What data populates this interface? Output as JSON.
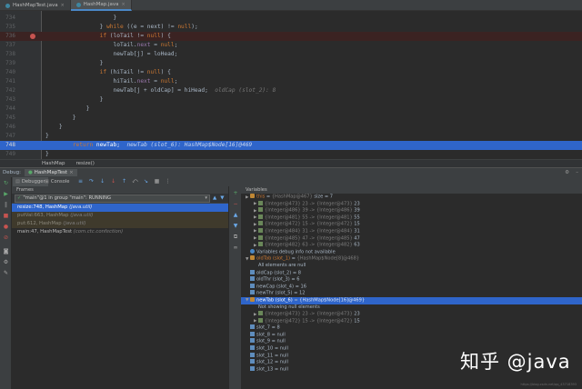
{
  "tabs": [
    {
      "label": "HashMapTest.java",
      "active": false
    },
    {
      "label": "HashMap.java",
      "active": true
    }
  ],
  "editor": {
    "lines": [
      {
        "no": "734",
        "parts": [
          {
            "t": "                    }",
            "c": ""
          }
        ]
      },
      {
        "no": "735",
        "parts": [
          {
            "t": "                } ",
            "c": ""
          },
          {
            "t": "while",
            "c": "kw"
          },
          {
            "t": " ((e = next) != ",
            "c": ""
          },
          {
            "t": "null",
            "c": "kw"
          },
          {
            "t": ");",
            "c": ""
          }
        ]
      },
      {
        "no": "736",
        "bp": true,
        "parts": [
          {
            "t": "                ",
            "c": ""
          },
          {
            "t": "if",
            "c": "kw"
          },
          {
            "t": " (loTail != ",
            "c": ""
          },
          {
            "t": "null",
            "c": "kw"
          },
          {
            "t": ") {",
            "c": ""
          }
        ]
      },
      {
        "no": "737",
        "parts": [
          {
            "t": "                    loTail.",
            "c": ""
          },
          {
            "t": "next",
            "c": "fld"
          },
          {
            "t": " = ",
            "c": ""
          },
          {
            "t": "null",
            "c": "kw"
          },
          {
            "t": ";",
            "c": ""
          }
        ]
      },
      {
        "no": "738",
        "parts": [
          {
            "t": "                    newTab[j] = loHead;",
            "c": ""
          }
        ]
      },
      {
        "no": "739",
        "parts": [
          {
            "t": "                }",
            "c": ""
          }
        ]
      },
      {
        "no": "740",
        "parts": [
          {
            "t": "                ",
            "c": ""
          },
          {
            "t": "if",
            "c": "kw"
          },
          {
            "t": " (hiTail != ",
            "c": ""
          },
          {
            "t": "null",
            "c": "kw"
          },
          {
            "t": ") {",
            "c": ""
          }
        ]
      },
      {
        "no": "741",
        "parts": [
          {
            "t": "                    hiTail.",
            "c": ""
          },
          {
            "t": "next",
            "c": "fld"
          },
          {
            "t": " = ",
            "c": ""
          },
          {
            "t": "null",
            "c": "kw"
          },
          {
            "t": ";",
            "c": ""
          }
        ]
      },
      {
        "no": "742",
        "parts": [
          {
            "t": "                    newTab[j + oldCap] = hiHead;  ",
            "c": ""
          },
          {
            "t": "oldCap (slot_2): 8",
            "c": "hint"
          }
        ]
      },
      {
        "no": "743",
        "parts": [
          {
            "t": "                }",
            "c": ""
          }
        ]
      },
      {
        "no": "744",
        "parts": [
          {
            "t": "            }",
            "c": ""
          }
        ]
      },
      {
        "no": "745",
        "parts": [
          {
            "t": "        }",
            "c": ""
          }
        ]
      },
      {
        "no": "746",
        "parts": [
          {
            "t": "    }",
            "c": ""
          }
        ]
      },
      {
        "no": "747",
        "parts": [
          {
            "t": "}",
            "c": ""
          }
        ]
      },
      {
        "no": "748",
        "cur": true,
        "parts": [
          {
            "t": "        ",
            "c": ""
          },
          {
            "t": "return",
            "c": "kw"
          },
          {
            "t": " newTab;  ",
            "c": ""
          },
          {
            "t": "newTab (slot_6): HashMap$Node[16]@469",
            "c": "hint"
          }
        ]
      },
      {
        "no": "749",
        "parts": [
          {
            "t": "}",
            "c": ""
          }
        ]
      }
    ]
  },
  "breadcrumb": [
    "HashMap",
    "resize()"
  ],
  "debug": {
    "title": "Debug:",
    "config": "HashMapTest",
    "subtabs": [
      "Debugger",
      "Console"
    ],
    "frames_title": "Frames",
    "variables_title": "Variables",
    "thread": "\"main\"@1 in group \"main\": RUNNING",
    "frames": [
      {
        "label": "resize:748, HashMap ",
        "src": "(java.util)",
        "kind": "active"
      },
      {
        "label": "putVal:663, HashMap ",
        "src": "(java.util)",
        "kind": "lib"
      },
      {
        "label": "put:612, HashMap ",
        "src": "(java.util)",
        "kind": "lib"
      },
      {
        "label": "main:47, HashMapTest ",
        "src": "(com.ctc.confection)",
        "kind": "normal"
      }
    ]
  },
  "variables": [
    {
      "indent": 0,
      "arrow": "▶",
      "icon": "obj",
      "name": "this",
      "val": " = ",
      "dim": "{HashMap@467}",
      "rest": "  size = 7"
    },
    {
      "indent": 1,
      "arrow": "▶",
      "icon": "arr",
      "name": "",
      "val": "",
      "dim": "{Integer@473} 23 -> {Integer@473}",
      "rest": " 23"
    },
    {
      "indent": 1,
      "arrow": "▶",
      "icon": "arr",
      "name": "",
      "val": "",
      "dim": "{Integer@486} 39 -> {Integer@486}",
      "rest": " 39"
    },
    {
      "indent": 1,
      "arrow": "▶",
      "icon": "arr",
      "name": "",
      "val": "",
      "dim": "{Integer@481} 55 -> {Integer@481}",
      "rest": " 55"
    },
    {
      "indent": 1,
      "arrow": "▶",
      "icon": "arr",
      "name": "",
      "val": "",
      "dim": "{Integer@472} 15 -> {Integer@472}",
      "rest": " 15"
    },
    {
      "indent": 1,
      "arrow": "▶",
      "icon": "arr",
      "name": "",
      "val": "",
      "dim": "{Integer@484} 31 -> {Integer@484}",
      "rest": " 31"
    },
    {
      "indent": 1,
      "arrow": "▶",
      "icon": "arr",
      "name": "",
      "val": "",
      "dim": "{Integer@485} 47 -> {Integer@485}",
      "rest": " 47"
    },
    {
      "indent": 1,
      "arrow": "▶",
      "icon": "arr",
      "name": "",
      "val": "",
      "dim": "{Integer@482} 63 -> {Integer@482}",
      "rest": " 63"
    },
    {
      "indent": 0,
      "arrow": "",
      "icon": "info",
      "name": "",
      "val": "",
      "dim": "",
      "rest": "Variables debug info not available"
    },
    {
      "indent": 0,
      "arrow": "▼",
      "icon": "obj",
      "name": "oldTab (slot_1)",
      "val": " = ",
      "dim": "{HashMap$Node[8]@468}",
      "rest": ""
    },
    {
      "indent": 1,
      "arrow": "",
      "icon": "",
      "name": "",
      "val": "",
      "dim": "",
      "rest": "All elements are null"
    },
    {
      "indent": 0,
      "arrow": "",
      "icon": "prm",
      "name": "oldCap (slot_2)",
      "val": " = 8",
      "dim": "",
      "rest": ""
    },
    {
      "indent": 0,
      "arrow": "",
      "icon": "prm",
      "name": "oldThr (slot_3)",
      "val": " = 6",
      "dim": "",
      "rest": ""
    },
    {
      "indent": 0,
      "arrow": "",
      "icon": "prm",
      "name": "newCap (slot_4)",
      "val": " = 16",
      "dim": "",
      "rest": ""
    },
    {
      "indent": 0,
      "arrow": "",
      "icon": "prm",
      "name": "newThr (slot_5)",
      "val": " = 12",
      "dim": "",
      "rest": ""
    },
    {
      "indent": 0,
      "arrow": "▼",
      "icon": "obj",
      "name": "newTab (slot_6)",
      "val": " = ",
      "dim": "{HashMap$Node[16]@469}",
      "rest": "",
      "sel": true
    },
    {
      "indent": 1,
      "arrow": "",
      "icon": "",
      "name": "",
      "val": "",
      "dim": "",
      "rest": "Not showing null elements"
    },
    {
      "indent": 1,
      "arrow": "▶",
      "icon": "arr",
      "name": "",
      "val": "",
      "dim": "{Integer@473} 23 -> {Integer@473}",
      "rest": " 23"
    },
    {
      "indent": 1,
      "arrow": "▶",
      "icon": "arr",
      "name": "",
      "val": "",
      "dim": "{Integer@472} 15 -> {Integer@472}",
      "rest": " 15"
    },
    {
      "indent": 0,
      "arrow": "",
      "icon": "prm",
      "name": "slot_7",
      "val": " = 8",
      "dim": "",
      "rest": ""
    },
    {
      "indent": 0,
      "arrow": "",
      "icon": "prm",
      "name": "slot_8",
      "val": " = null",
      "dim": "",
      "rest": ""
    },
    {
      "indent": 0,
      "arrow": "",
      "icon": "prm",
      "name": "slot_9",
      "val": " = null",
      "dim": "",
      "rest": ""
    },
    {
      "indent": 0,
      "arrow": "",
      "icon": "prm",
      "name": "slot_10",
      "val": " = null",
      "dim": "",
      "rest": ""
    },
    {
      "indent": 0,
      "arrow": "",
      "icon": "prm",
      "name": "slot_11",
      "val": " = null",
      "dim": "",
      "rest": ""
    },
    {
      "indent": 0,
      "arrow": "",
      "icon": "prm",
      "name": "slot_12",
      "val": " = null",
      "dim": "",
      "rest": ""
    },
    {
      "indent": 0,
      "arrow": "",
      "icon": "prm",
      "name": "slot_13",
      "val": " = null",
      "dim": "",
      "rest": ""
    }
  ],
  "watermark": {
    "text": "知乎 @java",
    "url": "https://blog.csdn.net/qq_43718393"
  },
  "colors": {
    "accent": "#2f65ca",
    "breakpoint": "#c75450",
    "keyword": "#cc7832",
    "field": "#9876aa"
  }
}
